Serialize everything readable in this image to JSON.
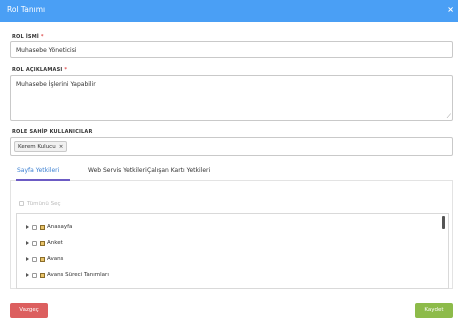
{
  "dialog": {
    "title": "Rol Tanımı"
  },
  "form": {
    "rol_name": {
      "label": "ROL İSMİ",
      "required": "*",
      "value": "Muhasebe Yöneticisi"
    },
    "rol_desc": {
      "label": "ROL AÇIKLAMASI",
      "required": "*",
      "value": "Muhasebe İşlerini Yapabilir"
    },
    "users": {
      "label": "ROLE SAHİP KULLANICILAR",
      "tags": [
        {
          "name": "Kerem Kulucu",
          "remove": "×"
        }
      ]
    }
  },
  "tabs": [
    {
      "label": "Sayfa Yetkileri",
      "active": true
    },
    {
      "label": "Web Servis Yetkileri",
      "active": false
    },
    {
      "label": "Çalışan Kartı Yetkileri",
      "active": false
    }
  ],
  "permissions": {
    "select_all": "Tümünü Seç",
    "items": [
      {
        "label": "Anasayfa"
      },
      {
        "label": "Anket"
      },
      {
        "label": "Avans"
      },
      {
        "label": "Avans Süreci Tanımları"
      }
    ]
  },
  "buttons": {
    "cancel": "Vazgeç",
    "save": "Kaydet"
  },
  "colors": {
    "header": "#4a9ff5",
    "cancel": "#dc5f5f",
    "save": "#8dbb4a",
    "active_tab": "#3a7fd2"
  },
  "icons": {
    "close": "close-icon",
    "folder": "folder-icon",
    "expand": "caret-right-icon",
    "checkbox": "checkbox-icon"
  }
}
